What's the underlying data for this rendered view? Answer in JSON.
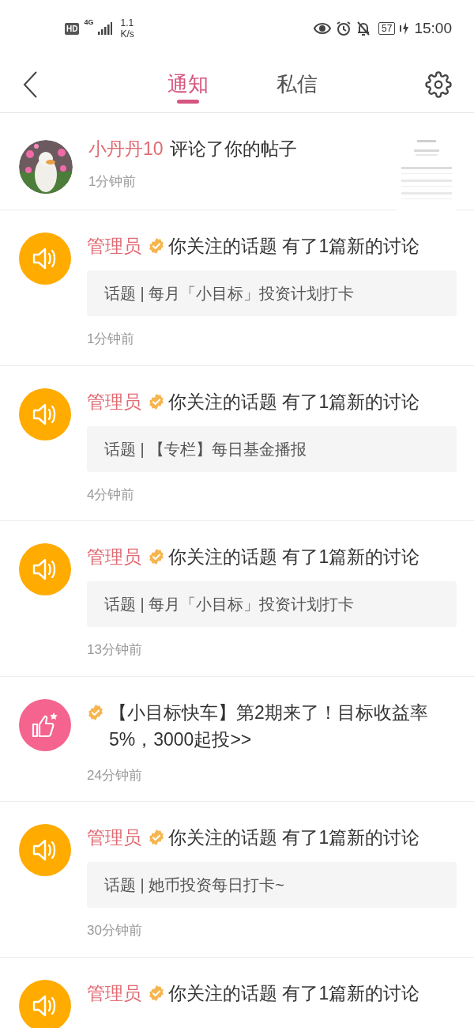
{
  "status_bar": {
    "hd": "HD",
    "network": "4G",
    "speed_value": "1.1",
    "speed_unit": "K/s",
    "battery": "57",
    "time": "15:00"
  },
  "tabs": [
    {
      "label": "通知",
      "selected": true
    },
    {
      "label": "私信",
      "selected": false
    }
  ],
  "notifications": [
    {
      "kind": "comment",
      "name": "小丹丹10",
      "text": "评论了你的帖子",
      "time": "1分钟前"
    },
    {
      "kind": "topic",
      "name": "管理员",
      "verified": true,
      "text": "你关注的话题 有了1篇新的讨论",
      "topic": "话题 | 每月「小目标」投资计划打卡",
      "time": "1分钟前"
    },
    {
      "kind": "topic",
      "name": "管理员",
      "verified": true,
      "text": "你关注的话题 有了1篇新的讨论",
      "topic": "话题 | 【专栏】每日基金播报",
      "time": "4分钟前"
    },
    {
      "kind": "topic",
      "name": "管理员",
      "verified": true,
      "text": "你关注的话题 有了1篇新的讨论",
      "topic": "话题 | 每月「小目标」投资计划打卡",
      "time": "13分钟前"
    },
    {
      "kind": "promo",
      "verified": true,
      "text": "【小目标快车】第2期来了！目标收益率5%，3000起投>>",
      "time": "24分钟前"
    },
    {
      "kind": "topic",
      "name": "管理员",
      "verified": true,
      "text": "你关注的话题 有了1篇新的讨论",
      "topic": "话题 | 她币投资每日打卡~",
      "time": "30分钟前"
    },
    {
      "kind": "topic",
      "name": "管理员",
      "verified": true,
      "text": "你关注的话题 有了1篇新的讨论"
    }
  ]
}
